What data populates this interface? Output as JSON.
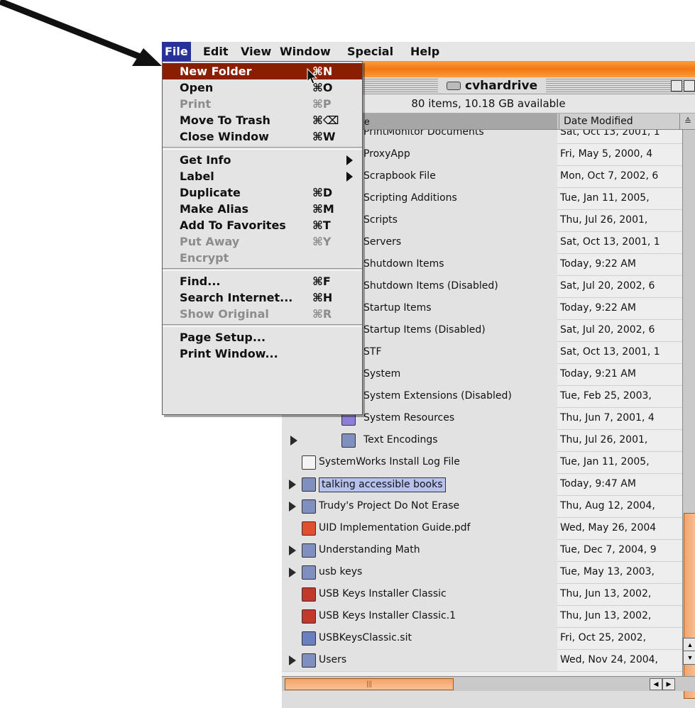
{
  "menubar": {
    "items": [
      "File",
      "Edit",
      "View",
      "Window",
      "Special",
      "Help"
    ]
  },
  "file_menu": {
    "items": [
      {
        "label": "New Folder",
        "shortcut": "⌘N",
        "state": "highlighted"
      },
      {
        "label": "Open",
        "shortcut": "⌘O",
        "state": "enabled"
      },
      {
        "label": "Print",
        "shortcut": "⌘P",
        "state": "disabled"
      },
      {
        "label": "Move To Trash",
        "shortcut": "⌘⌫",
        "state": "enabled"
      },
      {
        "label": "Close Window",
        "shortcut": "⌘W",
        "state": "enabled"
      },
      {
        "label": "Get Info",
        "shortcut": "",
        "state": "submenu"
      },
      {
        "label": "Label",
        "shortcut": "",
        "state": "submenu"
      },
      {
        "label": "Duplicate",
        "shortcut": "⌘D",
        "state": "enabled"
      },
      {
        "label": "Make Alias",
        "shortcut": "⌘M",
        "state": "enabled"
      },
      {
        "label": "Add To Favorites",
        "shortcut": "⌘T",
        "state": "enabled"
      },
      {
        "label": "Put Away",
        "shortcut": "⌘Y",
        "state": "disabled"
      },
      {
        "label": "Encrypt",
        "shortcut": "",
        "state": "disabled"
      },
      {
        "label": "Find...",
        "shortcut": "⌘F",
        "state": "enabled"
      },
      {
        "label": "Search Internet...",
        "shortcut": "⌘H",
        "state": "enabled"
      },
      {
        "label": "Show Original",
        "shortcut": "⌘R",
        "state": "disabled"
      },
      {
        "label": "Page Setup...",
        "shortcut": "",
        "state": "enabled"
      },
      {
        "label": "Print Window...",
        "shortcut": "",
        "state": "enabled"
      }
    ]
  },
  "window": {
    "title": "cvhardrive",
    "info": "80 items, 10.18 GB available",
    "columns": {
      "date": "Date Modified",
      "name_partial": "e"
    }
  },
  "rows": [
    {
      "name": "PrintMonitor Documents",
      "date": "Sat, Oct 13, 2001, 1",
      "indent": 1,
      "disclosure": false,
      "icon": "folder-icon"
    },
    {
      "name": "ProxyApp",
      "date": "Fri, May 5, 2000, 4",
      "indent": 1,
      "disclosure": false,
      "icon": "app-icon"
    },
    {
      "name": "Scrapbook File",
      "date": "Mon, Oct 7, 2002, 6",
      "indent": 1,
      "disclosure": false,
      "icon": "document-icon"
    },
    {
      "name": "Scripting Additions",
      "date": "Tue, Jan 11, 2005,",
      "indent": 1,
      "disclosure": false,
      "icon": "folder-icon"
    },
    {
      "name": "Scripts",
      "date": "Thu, Jul 26, 2001,",
      "indent": 1,
      "disclosure": false,
      "icon": "folder-icon"
    },
    {
      "name": "Servers",
      "date": "Sat, Oct 13, 2001, 1",
      "indent": 1,
      "disclosure": false,
      "icon": "folder-icon"
    },
    {
      "name": "Shutdown Items",
      "date": "Today, 9:22 AM",
      "indent": 1,
      "disclosure": false,
      "icon": "folder-icon"
    },
    {
      "name": "Shutdown Items (Disabled)",
      "date": "Sat, Jul 20, 2002, 6",
      "indent": 1,
      "disclosure": false,
      "icon": "folder-icon"
    },
    {
      "name": "Startup Items",
      "date": "Today, 9:22 AM",
      "indent": 1,
      "disclosure": false,
      "icon": "folder-icon"
    },
    {
      "name": "Startup Items (Disabled)",
      "date": "Sat, Jul 20, 2002, 6",
      "indent": 1,
      "disclosure": false,
      "icon": "folder-icon"
    },
    {
      "name": "STF",
      "date": "Sat, Oct 13, 2001, 1",
      "indent": 1,
      "disclosure": false,
      "icon": "folder-icon"
    },
    {
      "name": "System",
      "date": "Today, 9:21 AM",
      "indent": 1,
      "disclosure": false,
      "icon": "system-file-icon"
    },
    {
      "name": "System Extensions (Disabled)",
      "date": "Tue, Feb 25, 2003,",
      "indent": 1,
      "disclosure": true,
      "icon": "folder-icon"
    },
    {
      "name": "System Resources",
      "date": "Thu, Jun 7, 2001, 4",
      "indent": 1,
      "disclosure": false,
      "icon": "finder-icon"
    },
    {
      "name": "Text Encodings",
      "date": "Thu, Jul 26, 2001,",
      "indent": 1,
      "disclosure": true,
      "icon": "folder-icon"
    },
    {
      "name": "SystemWorks Install Log File",
      "date": "Tue, Jan 11, 2005,",
      "indent": 0,
      "disclosure": false,
      "icon": "document-icon"
    },
    {
      "name": "talking accessible books",
      "date": "Today, 9:47 AM",
      "indent": 0,
      "disclosure": true,
      "icon": "folder-icon",
      "selected": true
    },
    {
      "name": "Trudy's Project Do Not Erase",
      "date": "Thu, Aug 12, 2004,",
      "indent": 0,
      "disclosure": true,
      "icon": "folder-icon"
    },
    {
      "name": "UID Implementation Guide.pdf",
      "date": "Wed, May 26, 2004",
      "indent": 0,
      "disclosure": false,
      "icon": "pdf-icon"
    },
    {
      "name": "Understanding Math",
      "date": "Tue, Dec 7, 2004, 9",
      "indent": 0,
      "disclosure": true,
      "icon": "folder-icon"
    },
    {
      "name": "usb keys",
      "date": "Tue, May 13, 2003,",
      "indent": 0,
      "disclosure": true,
      "icon": "folder-icon"
    },
    {
      "name": "USB Keys Installer Classic",
      "date": "Thu, Jun 13, 2002,",
      "indent": 0,
      "disclosure": false,
      "icon": "installer-icon"
    },
    {
      "name": "USB Keys Installer Classic.1",
      "date": "Thu, Jun 13, 2002,",
      "indent": 0,
      "disclosure": false,
      "icon": "installer-icon"
    },
    {
      "name": "USBKeysClassic.sit",
      "date": "Fri, Oct 25, 2002,",
      "indent": 0,
      "disclosure": false,
      "icon": "archive-icon"
    },
    {
      "name": "Users",
      "date": "Wed, Nov 24, 2004,",
      "indent": 0,
      "disclosure": true,
      "icon": "users-folder-icon"
    }
  ]
}
